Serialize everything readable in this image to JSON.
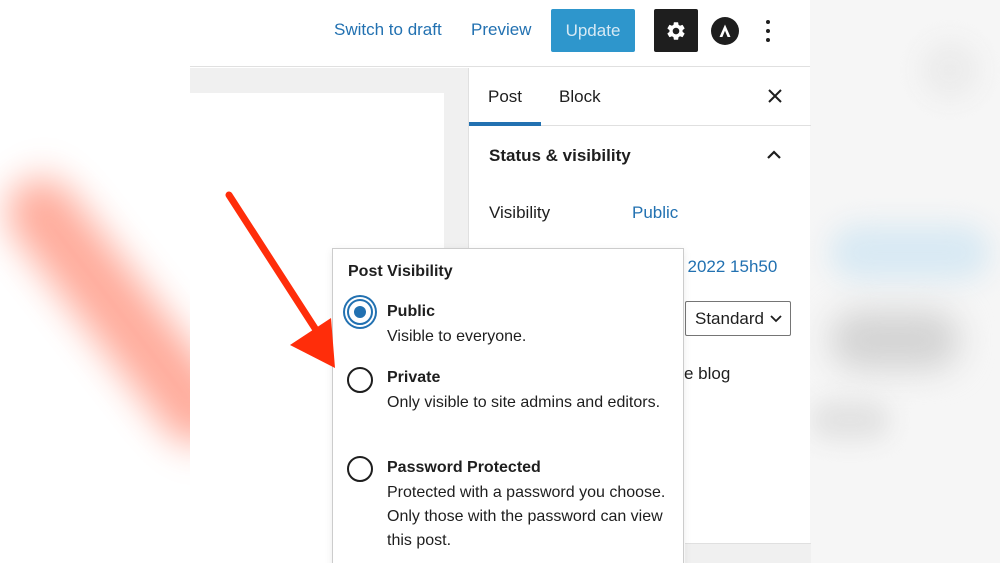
{
  "toolbar": {
    "switch_to_draft": "Switch to draft",
    "preview": "Preview",
    "update": "Update",
    "settings_icon": "gear-icon",
    "astra_icon": "astra-logo-icon",
    "more_icon": "more-vertical-icon"
  },
  "sidebar": {
    "tabs": [
      {
        "label": "Post",
        "active": true
      },
      {
        "label": "Block",
        "active": false
      }
    ],
    "close_icon": "close-icon",
    "section_title": "Status & visibility",
    "section_expanded": true,
    "visibility_label": "Visibility",
    "visibility_value": "Public",
    "publish_date_partial": "l 2022 15h50",
    "template_select_value": "Standard",
    "partial_text": "e blog"
  },
  "popover": {
    "title": "Post Visibility",
    "options": [
      {
        "label": "Public",
        "description": "Visible to everyone.",
        "checked": true
      },
      {
        "label": "Private",
        "description": "Only visible to site admins and editors.",
        "checked": false
      },
      {
        "label": "Password Protected",
        "description": "Protected with a password you choose. Only those with the password can view this post.",
        "checked": false
      }
    ]
  },
  "colors": {
    "accent": "#2271b1",
    "update_button": "#0a84c4",
    "arrow": "#ff2d0a",
    "dark": "#1e1e1e"
  }
}
